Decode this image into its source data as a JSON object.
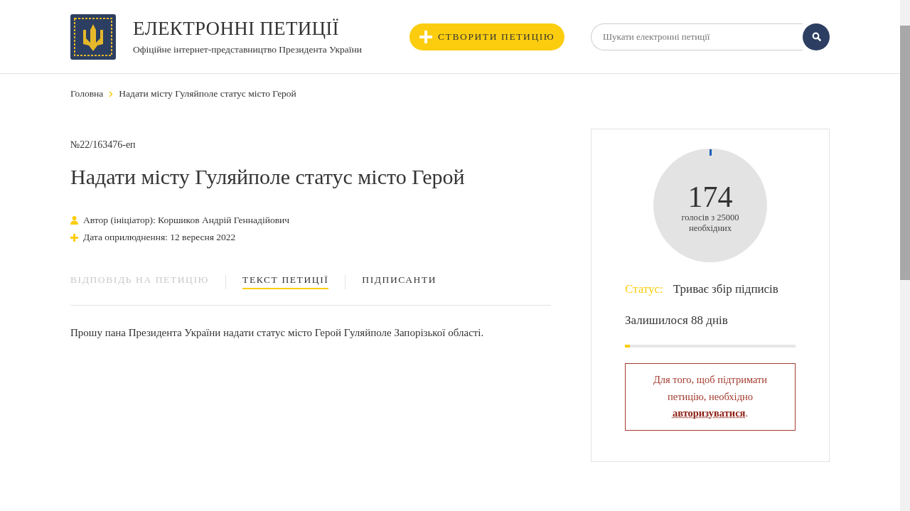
{
  "header": {
    "title": "ЕЛЕКТРОННІ ПЕТИЦІЇ",
    "subtitle": "Офіційне інтернет-представництво Президента України",
    "create_button": "СТВОРИТИ ПЕТИЦІЮ",
    "search": {
      "placeholder": "Шукати електронні петиції"
    }
  },
  "breadcrumbs": [
    {
      "label": "Головна"
    },
    {
      "label": "Надати місту Гуляйполе статус місто Герой"
    }
  ],
  "petition": {
    "number": "№22/163476-еп",
    "title": "Надати місту Гуляйполе статус місто Герой",
    "meta": [
      {
        "kind": "author",
        "text": "Автор (ініціатор): Коршиков Андрій Геннадійович"
      },
      {
        "kind": "date",
        "text": "Дата оприлюднення: 12 вересня 2022"
      }
    ],
    "tabs": [
      {
        "label": "ВІДПОВІДЬ НА ПЕТИЦІЮ",
        "selected": false,
        "disabled": true
      },
      {
        "label": "ТЕКСТ ПЕТИЦІЇ",
        "selected": true,
        "disabled": false
      },
      {
        "label": "ПІДПИСАНТИ",
        "selected": false,
        "disabled": false
      }
    ],
    "body": "Прошу пана Президента України надати статус місто Герой Гуляйполе Запорізької області."
  },
  "sidebar": {
    "votes": {
      "count": "174",
      "caption_line1": "голосів з 25000",
      "caption_line2": "необхідних"
    },
    "status_label": "Статус:",
    "status_value": "Триває збір підписів",
    "remaining": "Залишилося 88 днів",
    "remaining_bar": {
      "level": 0.03
    },
    "notice": {
      "text_before": "Для того, щоб підтримати петицію, необхідно",
      "link": "авторизуватися",
      "text_after": "."
    }
  }
}
